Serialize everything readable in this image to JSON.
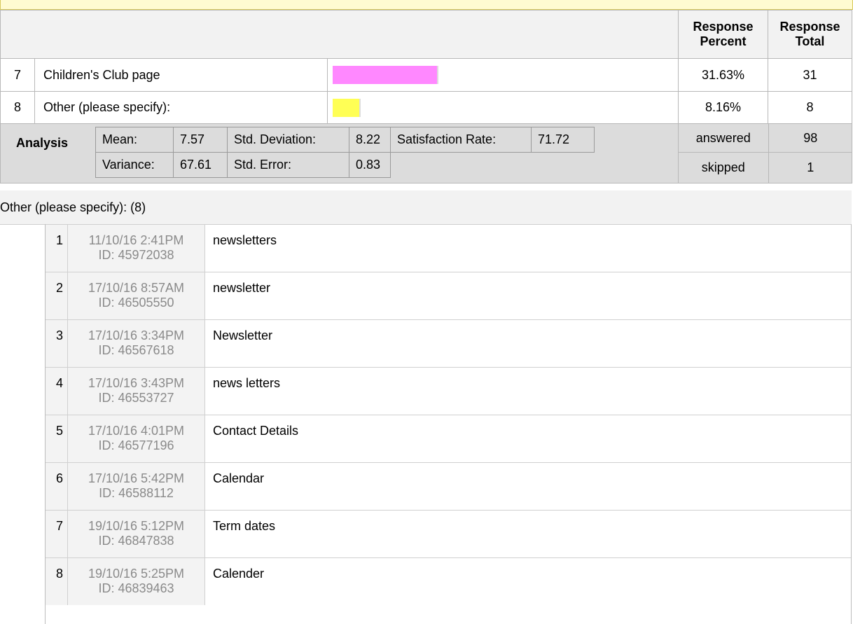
{
  "header": {
    "response_percent": "Response Percent",
    "response_total": "Response Total"
  },
  "rows": [
    {
      "num": "7",
      "label": "Children's Club page",
      "percent": "31.63%",
      "total": "31",
      "bar_color": "#ff88ff",
      "bar_fraction": 0.3163
    },
    {
      "num": "8",
      "label": "Other (please specify):",
      "percent": "8.16%",
      "total": "8",
      "bar_color": "#ffff55",
      "bar_fraction": 0.0816
    }
  ],
  "analysis": {
    "title": "Analysis",
    "mean_label": "Mean:",
    "mean": "7.57",
    "std_dev_label": "Std. Deviation:",
    "std_dev": "8.22",
    "satisfaction_label": "Satisfaction Rate:",
    "satisfaction": "71.72",
    "variance_label": "Variance:",
    "variance": "67.61",
    "std_err_label": "Std. Error:",
    "std_err": "0.83",
    "answered_label": "answered",
    "answered": "98",
    "skipped_label": "skipped",
    "skipped": "1"
  },
  "other": {
    "title": "Other (please specify): (8)",
    "responses": [
      {
        "n": "1",
        "date": "11/10/16 2:41PM",
        "id": "ID: 45972038",
        "text": "newsletters"
      },
      {
        "n": "2",
        "date": "17/10/16 8:57AM",
        "id": "ID: 46505550",
        "text": "newsletter"
      },
      {
        "n": "3",
        "date": "17/10/16 3:34PM",
        "id": "ID: 46567618",
        "text": "Newsletter"
      },
      {
        "n": "4",
        "date": "17/10/16 3:43PM",
        "id": "ID: 46553727",
        "text": "news letters"
      },
      {
        "n": "5",
        "date": "17/10/16 4:01PM",
        "id": "ID: 46577196",
        "text": "Contact Details"
      },
      {
        "n": "6",
        "date": "17/10/16 5:42PM",
        "id": "ID: 46588112",
        "text": "Calendar"
      },
      {
        "n": "7",
        "date": "19/10/16 5:12PM",
        "id": "ID: 46847838",
        "text": "Term dates"
      },
      {
        "n": "8",
        "date": "19/10/16 5:25PM",
        "id": "ID: 46839463",
        "text": "Calender"
      }
    ]
  }
}
